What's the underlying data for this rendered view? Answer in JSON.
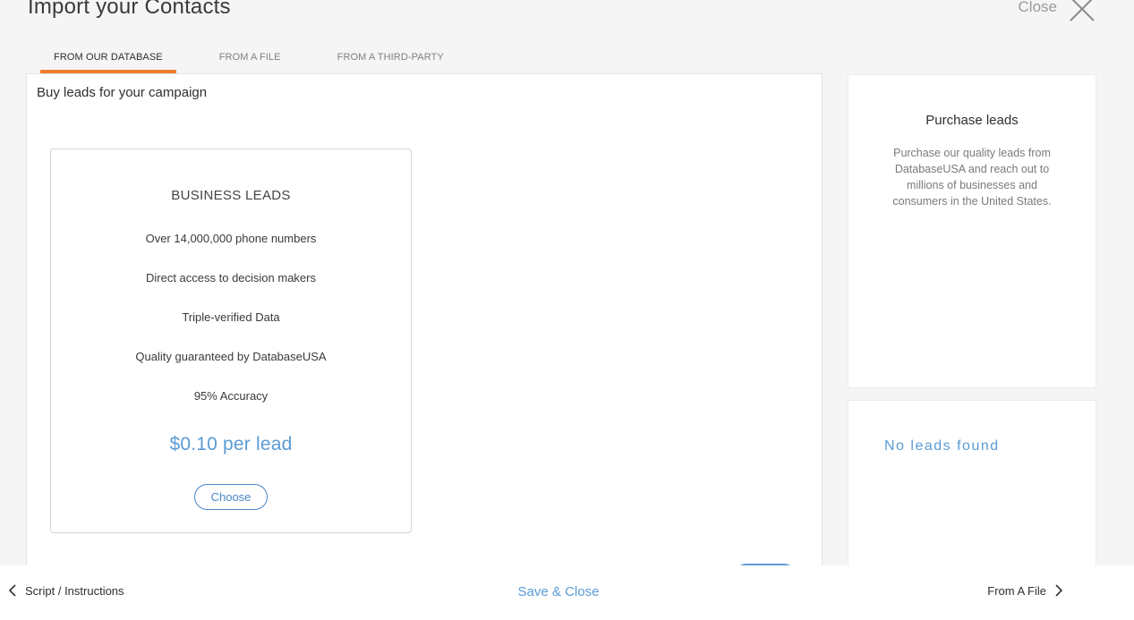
{
  "header": {
    "title": "Import your Contacts",
    "close_label": "Close"
  },
  "tabs": [
    {
      "label": "FROM OUR DATABASE",
      "active": true
    },
    {
      "label": "FROM A FILE",
      "active": false
    },
    {
      "label": "FROM A THIRD-PARTY",
      "active": false
    }
  ],
  "main": {
    "heading": "Buy leads for your campaign",
    "card": {
      "title": "BUSINESS LEADS",
      "features": [
        "Over 14,000,000 phone numbers",
        "Direct access to decision makers",
        "Triple-verified Data",
        "Quality guaranteed by DatabaseUSA",
        "95% Accuracy"
      ],
      "price": "$0.10 per lead",
      "choose_label": "Choose"
    }
  },
  "side": {
    "title": "Purchase leads",
    "description": "Purchase our quality leads from DatabaseUSA and reach out to millions of businesses and consumers in the United States.",
    "no_leads": "No leads found"
  },
  "footer": {
    "back_label": "Script / Instructions",
    "save_label": "Save & Close",
    "next_label": "From A File"
  },
  "colors": {
    "accent": "#5b9bd5",
    "tab_indicator": "#ef7d2d",
    "button_border": "#4a86c7"
  },
  "icons": {
    "close": "close-icon",
    "back": "chevron-left-icon",
    "next": "chevron-right-icon"
  }
}
